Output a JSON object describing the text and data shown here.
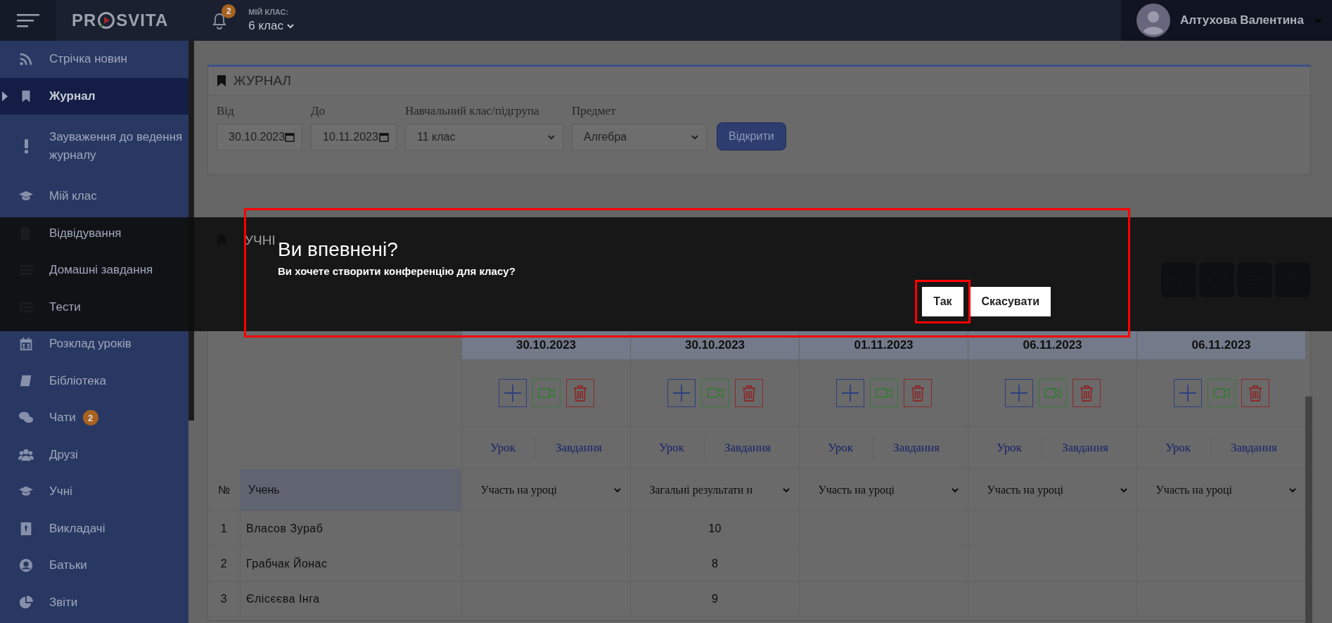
{
  "topbar": {
    "logo": {
      "text_start": "PR",
      "text_end": "SVITA"
    },
    "notification_count": "2",
    "class_label": "МІЙ КЛАС:",
    "class_value": "6 клас",
    "user_name": "Алтухова Валентина"
  },
  "sidebar": {
    "items": [
      {
        "label": "Стрічка новин",
        "selected": false
      },
      {
        "label": "Журнал",
        "selected": true
      },
      {
        "label": "Зауваження до ведення журналу",
        "selected": false
      },
      {
        "label": "Мій клас",
        "selected": false
      },
      {
        "label": "Відвідування",
        "selected": false
      },
      {
        "label": "Домашні завдання",
        "selected": false
      },
      {
        "label": "Тести",
        "selected": false
      },
      {
        "label": "Розклад уроків",
        "selected": false
      },
      {
        "label": "Бібліотека",
        "selected": false
      },
      {
        "label": "Чати",
        "selected": false,
        "badge": "2"
      },
      {
        "label": "Друзі",
        "selected": false
      },
      {
        "label": "Учні",
        "selected": false
      },
      {
        "label": "Викладачі",
        "selected": false
      },
      {
        "label": "Батьки",
        "selected": false
      },
      {
        "label": "Звіти",
        "selected": false
      }
    ]
  },
  "journal": {
    "title": "ЖУРНАЛ",
    "fields": [
      {
        "label": "Від",
        "value": "30.10.2023",
        "kind": "date"
      },
      {
        "label": "До",
        "value": "10.11.2023",
        "kind": "date"
      },
      {
        "label": "Навчальний клас/підгрупа",
        "value": "11 клас",
        "kind": "select"
      },
      {
        "label": "Предмет",
        "value": "Алгебра",
        "kind": "select"
      }
    ],
    "open_button": "Відкрити"
  },
  "students": {
    "title": "УЧНІ",
    "number_header": "№",
    "student_header": "Учень",
    "lessons": [
      {
        "date": "30.10.2023",
        "lesson_tab": "Урок",
        "task_tab": "Завдання",
        "mode": "Участь на уроці"
      },
      {
        "date": "30.10.2023",
        "lesson_tab": "Урок",
        "task_tab": "Завдання",
        "mode": "Загальні результати н",
        "grades": [
          "10",
          "8",
          "9"
        ]
      },
      {
        "date": "01.11.2023",
        "lesson_tab": "Урок",
        "task_tab": "Завдання",
        "mode": "Участь на уроці"
      },
      {
        "date": "06.11.2023",
        "lesson_tab": "Урок",
        "task_tab": "Завдання",
        "mode": "Участь на уроці"
      },
      {
        "date": "06.11.2023",
        "lesson_tab": "Урок",
        "task_tab": "Завдання",
        "mode": "Участь на уроці"
      }
    ],
    "rows": [
      {
        "number": "1",
        "name": "Власов Зураб"
      },
      {
        "number": "2",
        "name": "Грабчак Йонас"
      },
      {
        "number": "3",
        "name": "Єлісєєва Інга"
      }
    ]
  },
  "dialog": {
    "title": "Ви впевнені?",
    "message": "Ви хочете створити конференцію для класу?",
    "highlighted": true,
    "buttons": [
      {
        "label": "Так",
        "highlighted": true
      },
      {
        "label": "Скасувати",
        "highlighted": false
      }
    ]
  }
}
